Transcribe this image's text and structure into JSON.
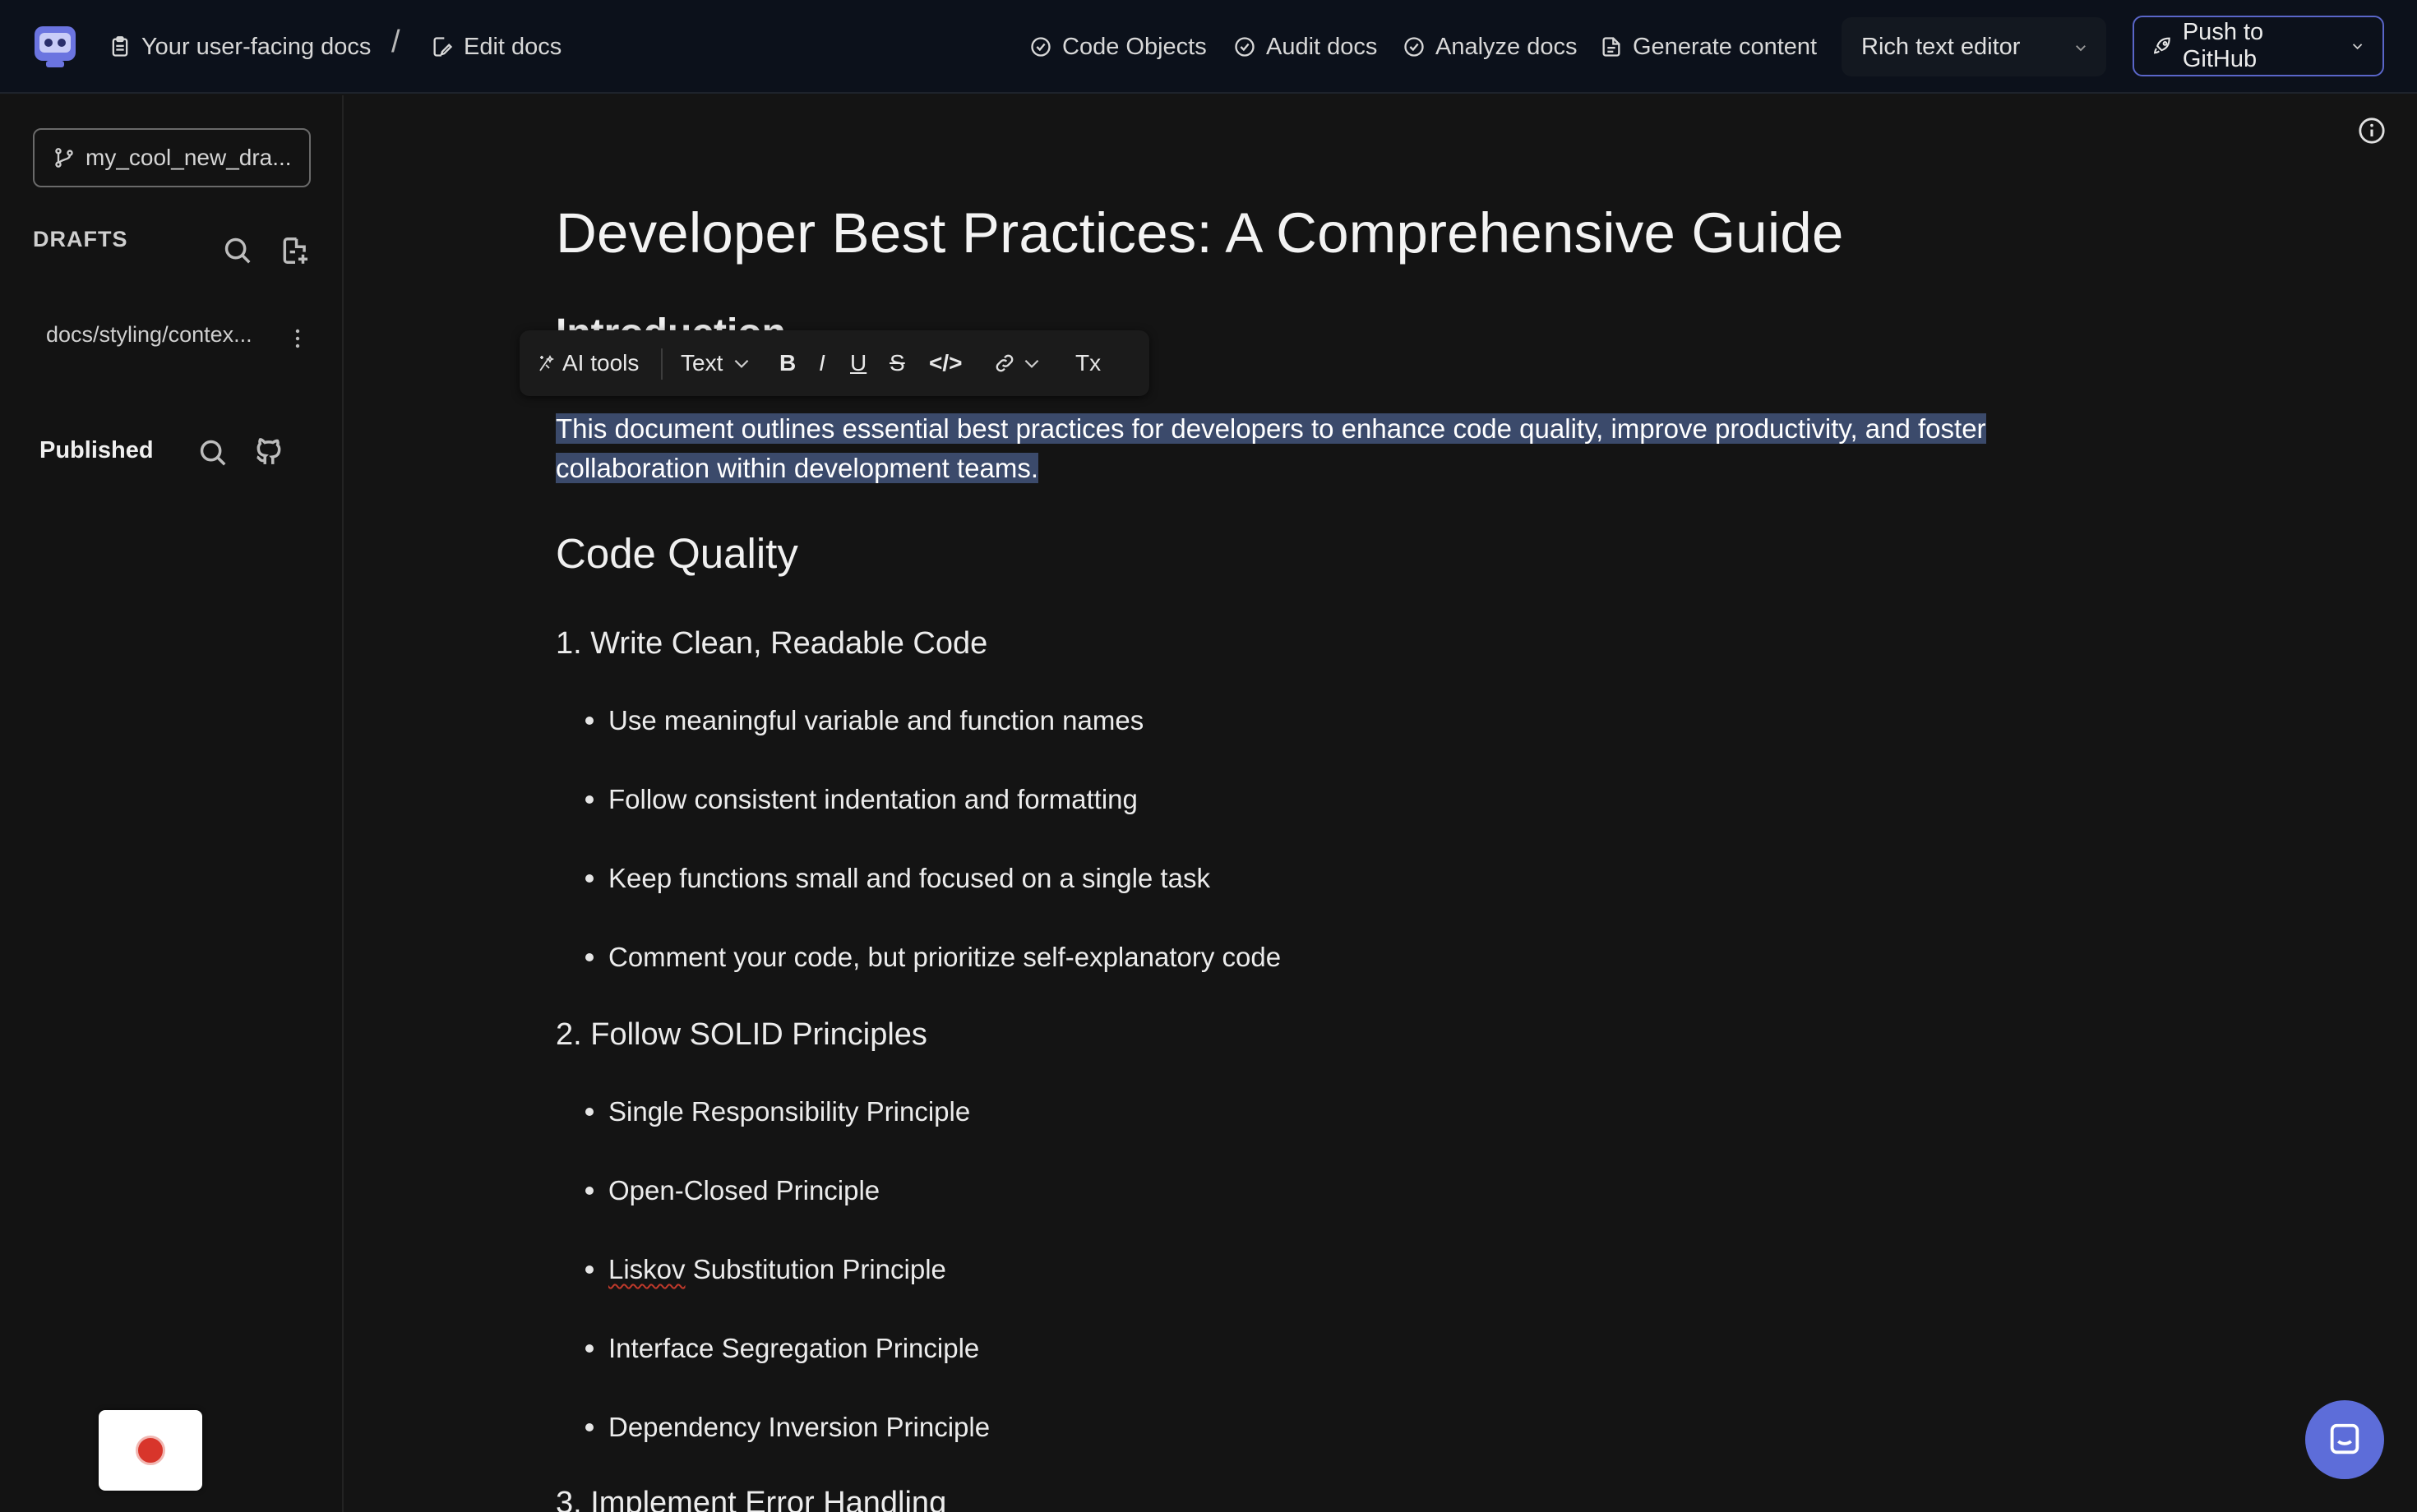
{
  "topbar": {
    "breadcrumb_docs": "Your user-facing docs",
    "breadcrumb_sep": "/",
    "breadcrumb_edit": "Edit docs",
    "nav": [
      {
        "label": "Code Objects",
        "icon": "check-circle-icon"
      },
      {
        "label": "Audit docs",
        "icon": "check-circle-icon"
      },
      {
        "label": "Analyze docs",
        "icon": "check-circle-icon"
      },
      {
        "label": "Generate content",
        "icon": "document-icon"
      }
    ],
    "editor_mode": "Rich text editor",
    "push_label": "Push to GitHub",
    "accent": "#5a66c9"
  },
  "sidebar": {
    "branch": "my_cool_new_dra...",
    "drafts_heading": "DRAFTS",
    "draft_items": [
      "docs/styling/contex..."
    ],
    "published_heading": "Published"
  },
  "toolbar": {
    "ai_tools": "AI tools",
    "text_style": "Text",
    "bold": "B",
    "italic": "I",
    "underline": "U",
    "strike": "S",
    "code": "</>",
    "clear_format": "Tx"
  },
  "document": {
    "title": "Developer Best Practices: A Comprehensive Guide",
    "intro_heading": "Introduction",
    "intro_para": "This document outlines essential best practices for developers to enhance code quality, improve productivity, and foster collaboration within development teams.",
    "section_heading": "Code Quality",
    "sub1": "1. Write Clean, Readable Code",
    "sub1_items": [
      "Use meaningful variable and function names",
      "Follow consistent indentation and formatting",
      "Keep functions small and focused on a single task",
      "Comment your code, but prioritize self-explanatory code"
    ],
    "sub2": "2. Follow SOLID Principles",
    "sub2_items": [
      "Single Responsibility Principle",
      "Open-Closed Principle",
      "Liskov",
      "Interface Segregation Principle",
      "Dependency Inversion Principle"
    ],
    "sub2_item3_rest": " Substitution Principle",
    "sub3": "3. Implement Error Handling"
  }
}
